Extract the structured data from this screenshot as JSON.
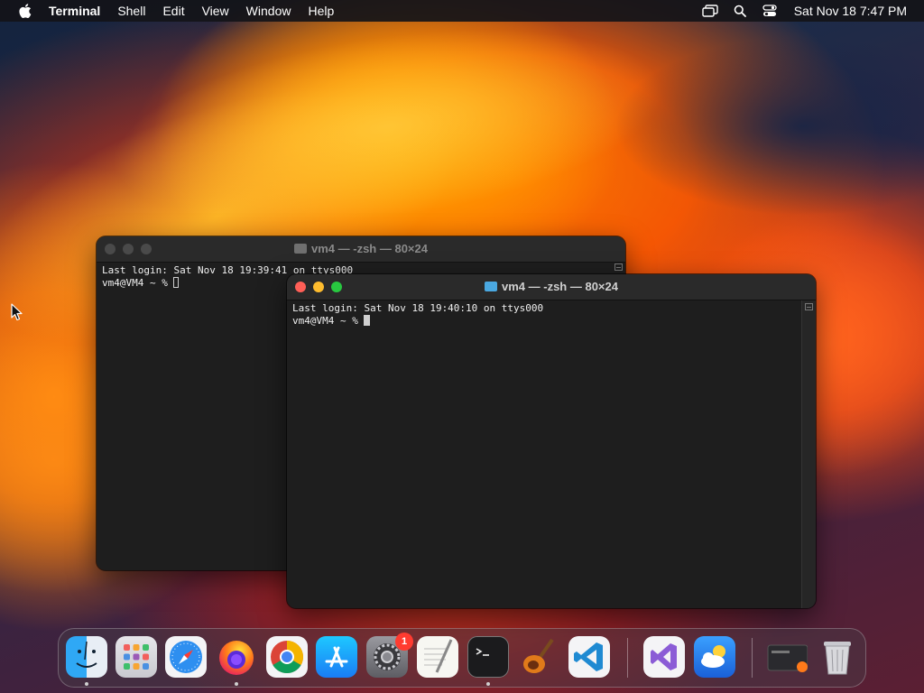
{
  "menubar": {
    "app_name": "Terminal",
    "menus": [
      "Shell",
      "Edit",
      "View",
      "Window",
      "Help"
    ],
    "clock": "Sat Nov 18  7:47 PM"
  },
  "windows": {
    "back": {
      "title": "vm4 — -zsh — 80×24",
      "lines": [
        "Last login: Sat Nov 18 19:39:41 on ttys000",
        "vm4@VM4 ~ % "
      ]
    },
    "front": {
      "title": "vm4 — -zsh — 80×24",
      "lines": [
        "Last login: Sat Nov 18 19:40:10 on ttys000",
        "vm4@VM4 ~ % "
      ]
    }
  },
  "dock": {
    "items": [
      {
        "name": "finder",
        "icon": "finder-icon"
      },
      {
        "name": "launchpad",
        "icon": "launchpad-icon"
      },
      {
        "name": "safari",
        "icon": "safari-icon"
      },
      {
        "name": "firefox",
        "icon": "firefox-icon"
      },
      {
        "name": "chrome",
        "icon": "chrome-icon"
      },
      {
        "name": "app-store",
        "icon": "app-store-icon"
      },
      {
        "name": "system-settings",
        "icon": "gear-icon",
        "badge": "1"
      },
      {
        "name": "textedit",
        "icon": "textedit-icon"
      },
      {
        "name": "terminal",
        "icon": "terminal-icon"
      },
      {
        "name": "garageband",
        "icon": "guitar-icon"
      },
      {
        "name": "vscode",
        "icon": "vscode-icon"
      },
      {
        "name": "visual-studio",
        "icon": "visual-studio-icon"
      },
      {
        "name": "weather",
        "icon": "weather-icon"
      },
      {
        "name": "downloads-stack",
        "icon": "folder-stack-icon"
      },
      {
        "name": "trash",
        "icon": "trash-icon"
      }
    ]
  },
  "colors": {
    "close": "#ff5f57",
    "minimize": "#febc2e",
    "maximize": "#28c840",
    "badge": "#ff3b30"
  }
}
